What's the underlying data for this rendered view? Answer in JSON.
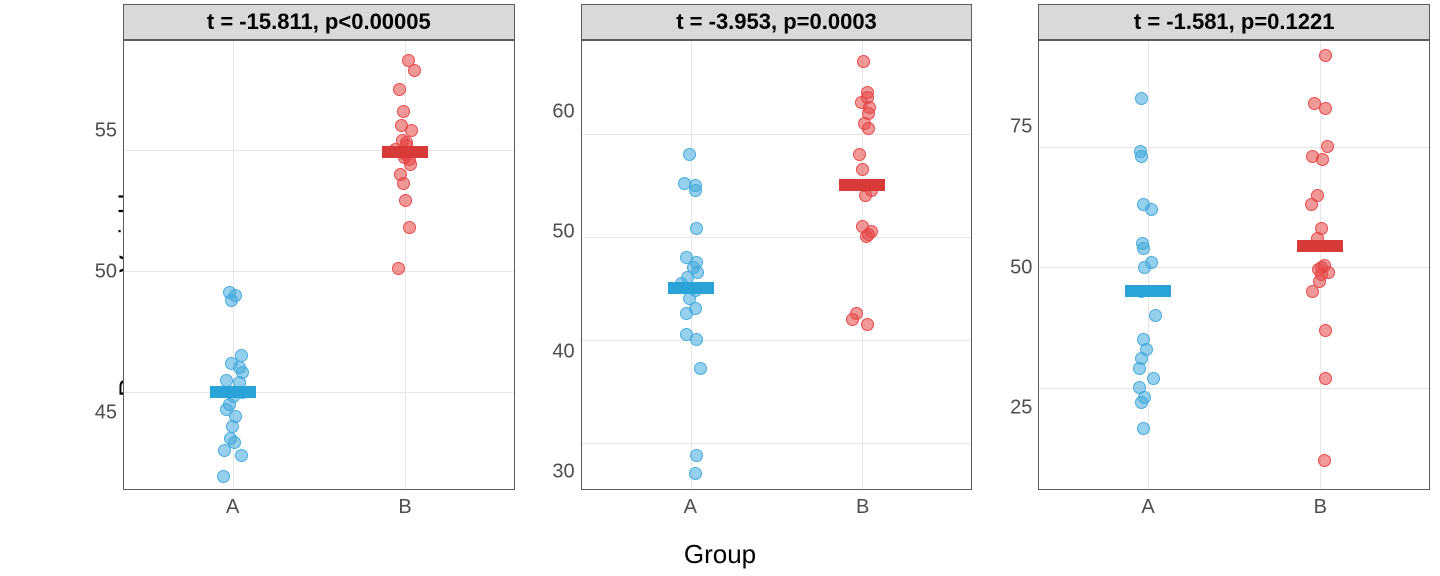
{
  "ylabel": "Response Variable",
  "xlabel": "Group",
  "categories": [
    "A",
    "B"
  ],
  "colors": {
    "A": "#2aa3d8",
    "B": "#d83a3a"
  },
  "chart_data": [
    {
      "type": "scatter",
      "strip": "t = -15.811, p<0.00005",
      "yticks": [
        45,
        50,
        55
      ],
      "ylim": [
        41,
        59.5
      ],
      "series": [
        {
          "name": "A",
          "mean": 45.0,
          "values": [
            41.5,
            42.4,
            42.6,
            42.9,
            43.1,
            43.6,
            44.0,
            44.3,
            44.5,
            44.8,
            45.0,
            45.4,
            45.5,
            45.8,
            46.0,
            46.2,
            46.5,
            48.8,
            49.0,
            49.1
          ]
        },
        {
          "name": "B",
          "mean": 54.9,
          "values": [
            50.1,
            51.8,
            52.9,
            53.6,
            54.0,
            54.4,
            54.6,
            54.7,
            54.8,
            54.9,
            55.0,
            55.2,
            55.3,
            55.4,
            55.8,
            56.0,
            56.6,
            57.5,
            58.3,
            58.7
          ]
        }
      ]
    },
    {
      "type": "scatter",
      "strip": "t = -3.953, p=0.0003",
      "yticks": [
        30,
        40,
        50,
        60
      ],
      "ylim": [
        25.5,
        69
      ],
      "series": [
        {
          "name": "A",
          "mean": 45.0,
          "values": [
            27.0,
            28.8,
            37.2,
            40.0,
            40.5,
            42.5,
            43.0,
            44.0,
            44.8,
            45.5,
            46.0,
            46.5,
            47.0,
            47.5,
            48.0,
            50.8,
            54.5,
            55.0,
            55.2,
            58.0
          ]
        },
        {
          "name": "B",
          "mean": 55.0,
          "values": [
            41.5,
            42.0,
            42.5,
            50.0,
            50.2,
            50.5,
            51.0,
            54.0,
            54.5,
            55.0,
            56.5,
            58.0,
            60.5,
            61.0,
            62.0,
            62.5,
            63.0,
            63.5,
            64.0,
            67.0
          ]
        }
      ]
    },
    {
      "type": "scatter",
      "strip": "t = -1.581, p=0.1221",
      "yticks": [
        25,
        50,
        75
      ],
      "ylim": [
        4,
        97
      ],
      "series": [
        {
          "name": "A",
          "mean": 45.0,
          "values": [
            16.5,
            22.0,
            23.0,
            25.0,
            27.0,
            29.0,
            31.0,
            33.0,
            35.0,
            40.0,
            45.0,
            50.0,
            51.0,
            54.0,
            55.0,
            62.0,
            63.0,
            73.0,
            74.0,
            85.0
          ]
        },
        {
          "name": "B",
          "mean": 54.5,
          "values": [
            10.0,
            27.0,
            37.0,
            45.0,
            47.0,
            48.5,
            49.0,
            49.5,
            50.0,
            50.5,
            56.0,
            58.0,
            63.0,
            65.0,
            72.5,
            73.0,
            75.0,
            83.0,
            84.0,
            94.0
          ]
        }
      ]
    }
  ]
}
